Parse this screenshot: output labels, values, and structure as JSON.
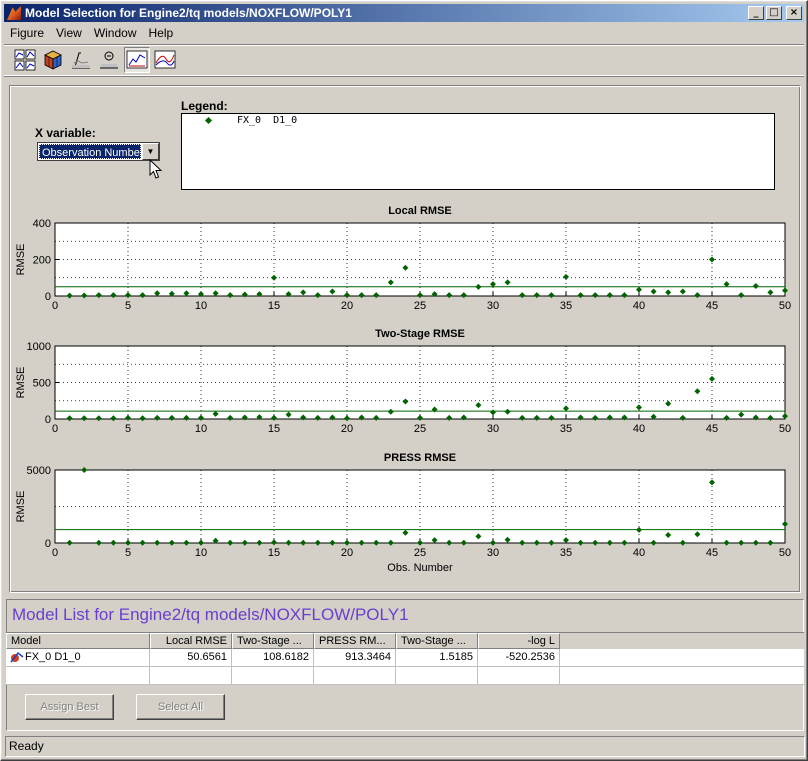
{
  "window": {
    "title": "Model Selection for Engine2/tq models/NOXFLOW/POLY1",
    "minimize_glyph": "_",
    "maximize_glyph": "□",
    "close_glyph": "×"
  },
  "menu": [
    "Figure",
    "View",
    "Window",
    "Help"
  ],
  "toolbar": {
    "icons": [
      "scatter-plot-icon",
      "cube-plot-icon",
      "bar-plot-icon",
      "cross-section-icon",
      "rmse-plot-icon",
      "response-curve-icon"
    ],
    "pressed_index": 4
  },
  "controls": {
    "xvar_label": "X variable:",
    "xvar_selected": "Observation Number",
    "legend_label": "Legend:",
    "legend_entry": "FX_0  D1_0"
  },
  "colors": {
    "series": "#006400",
    "accent_title": "#6a3fd0",
    "selection": "#0a246a"
  },
  "chart_data": [
    {
      "type": "scatter",
      "title": "Local RMSE",
      "ylabel": "RMSE",
      "xlabel": "",
      "xlim": [
        0,
        50
      ],
      "ylim": [
        0,
        400
      ],
      "yticks": [
        0,
        200,
        400
      ],
      "xticks": [
        0,
        5,
        10,
        15,
        20,
        25,
        30,
        35,
        40,
        45,
        50
      ],
      "grid": true,
      "reference_line": 50.6561,
      "x": [
        1,
        2,
        3,
        4,
        5,
        6,
        7,
        8,
        9,
        10,
        11,
        12,
        13,
        14,
        15,
        16,
        17,
        18,
        19,
        20,
        21,
        22,
        23,
        24,
        25,
        26,
        27,
        28,
        29,
        30,
        31,
        32,
        33,
        34,
        35,
        36,
        37,
        38,
        39,
        40,
        41,
        42,
        43,
        44,
        45,
        46,
        47,
        48,
        49,
        50
      ],
      "y": [
        2,
        3,
        5,
        5,
        5,
        5,
        15,
        12,
        15,
        10,
        15,
        5,
        8,
        10,
        100,
        10,
        20,
        5,
        25,
        5,
        5,
        5,
        75,
        155,
        5,
        10,
        5,
        5,
        50,
        65,
        75,
        5,
        5,
        5,
        105,
        5,
        5,
        5,
        5,
        35,
        25,
        20,
        25,
        5,
        200,
        65,
        5,
        55,
        20,
        30
      ]
    },
    {
      "type": "scatter",
      "title": "Two-Stage RMSE",
      "ylabel": "RMSE",
      "xlabel": "",
      "xlim": [
        0,
        50
      ],
      "ylim": [
        0,
        1000
      ],
      "yticks": [
        0,
        500,
        1000
      ],
      "xticks": [
        0,
        5,
        10,
        15,
        20,
        25,
        30,
        35,
        40,
        45,
        50
      ],
      "grid": true,
      "reference_line": 108.6182,
      "x": [
        1,
        2,
        3,
        4,
        5,
        6,
        7,
        8,
        9,
        10,
        11,
        12,
        13,
        14,
        15,
        16,
        17,
        18,
        19,
        20,
        21,
        22,
        23,
        24,
        25,
        26,
        27,
        28,
        29,
        30,
        31,
        32,
        33,
        34,
        35,
        36,
        37,
        38,
        39,
        40,
        41,
        42,
        43,
        44,
        45,
        46,
        47,
        48,
        49,
        50
      ],
      "y": [
        10,
        10,
        10,
        10,
        15,
        10,
        15,
        15,
        15,
        15,
        70,
        15,
        20,
        25,
        15,
        60,
        20,
        15,
        20,
        10,
        20,
        15,
        100,
        240,
        15,
        130,
        15,
        20,
        190,
        90,
        100,
        15,
        15,
        15,
        145,
        20,
        15,
        20,
        20,
        160,
        30,
        210,
        15,
        380,
        550,
        15,
        60,
        20,
        15,
        40
      ]
    },
    {
      "type": "scatter",
      "title": "PRESS RMSE",
      "ylabel": "RMSE",
      "xlabel": "Obs. Number",
      "xlim": [
        0,
        50
      ],
      "ylim": [
        0,
        5000
      ],
      "yticks": [
        0,
        5000
      ],
      "xticks": [
        0,
        5,
        10,
        15,
        20,
        25,
        30,
        35,
        40,
        45,
        50
      ],
      "grid": true,
      "reference_line": 913.3464,
      "x": [
        1,
        2,
        3,
        4,
        5,
        6,
        7,
        8,
        9,
        10,
        11,
        12,
        13,
        14,
        15,
        16,
        17,
        18,
        19,
        20,
        21,
        22,
        23,
        24,
        25,
        26,
        27,
        28,
        29,
        30,
        31,
        32,
        33,
        34,
        35,
        36,
        37,
        38,
        39,
        40,
        41,
        42,
        43,
        44,
        45,
        46,
        47,
        48,
        49,
        50
      ],
      "y": [
        20,
        5000,
        20,
        20,
        20,
        20,
        20,
        20,
        20,
        20,
        150,
        20,
        20,
        20,
        40,
        20,
        20,
        20,
        20,
        20,
        20,
        20,
        20,
        700,
        20,
        200,
        20,
        20,
        450,
        20,
        220,
        20,
        20,
        20,
        200,
        20,
        20,
        20,
        20,
        900,
        20,
        550,
        20,
        600,
        4150,
        20,
        20,
        20,
        20,
        1300
      ]
    }
  ],
  "model_list": {
    "title": "Model List for Engine2/tq models/NOXFLOW/POLY1",
    "columns": [
      "Model",
      "Local RMSE",
      "Two-Stage ...",
      "PRESS RM...",
      "Two-Stage ...",
      "-log L"
    ],
    "rows": [
      [
        "FX_0 D1_0",
        "50.6561",
        "108.6182",
        "913.3464",
        "1.5185",
        "-520.2536"
      ]
    ]
  },
  "buttons": {
    "assign_best": "Assign Best",
    "select_all": "Select All"
  },
  "status": "Ready"
}
